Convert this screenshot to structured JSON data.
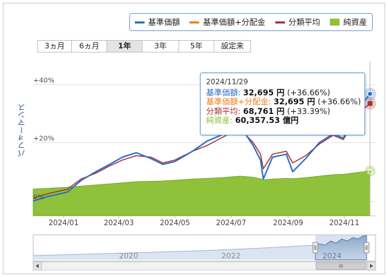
{
  "legend": {
    "items": [
      {
        "label": "基準価額",
        "color": "#2a6ec8",
        "kind": "line"
      },
      {
        "label": "基準価額+分配金",
        "color": "#f07d1d",
        "kind": "line"
      },
      {
        "label": "分類平均",
        "color": "#a83232",
        "kind": "line"
      },
      {
        "label": "純資産",
        "color": "#8fc13b",
        "kind": "box"
      }
    ]
  },
  "range_tabs": [
    {
      "label": "3ヵ月",
      "selected": false
    },
    {
      "label": "6ヵ月",
      "selected": false
    },
    {
      "label": "1年",
      "selected": true
    },
    {
      "label": "3年",
      "selected": false
    },
    {
      "label": "5年",
      "selected": false
    },
    {
      "label": "設定来",
      "selected": false
    }
  ],
  "tooltip": {
    "date": "2024/11/29",
    "rows": [
      {
        "label": "基準価額:",
        "value": "32,695 円",
        "rest": " (+36.66%)",
        "color": "#2a6ec8"
      },
      {
        "label": "基準価額+分配金:",
        "value": "32,695 円",
        "rest": " (+36.66%)",
        "color": "#f07d1d"
      },
      {
        "label": "分類平均:",
        "value": "68,761 円",
        "rest": " (+33.39%)",
        "color": "#a83232"
      },
      {
        "label": "純資産:",
        "value": "60,357.53 億円",
        "rest": "",
        "color": "#8fc13b"
      }
    ]
  },
  "navigator": {
    "year_labels": [
      "2020",
      "2022",
      "2024"
    ]
  },
  "chart_data": {
    "type": "line",
    "ylabel": "パフォーマンス",
    "y_tick_labels": [
      "+40%",
      "+20%",
      "0%"
    ],
    "y_ticks": [
      40,
      20,
      0
    ],
    "ylim": [
      -5,
      48
    ],
    "x_tick_labels": [
      "2024/01",
      "2024/03",
      "2024/05",
      "2024/07",
      "2024/09",
      "2024/11"
    ],
    "x_ticks": [
      "2024-01-01",
      "2024-03-01",
      "2024-05-01",
      "2024-07-01",
      "2024-09-01",
      "2024-11-01"
    ],
    "xlim": [
      "2023-11-29",
      "2024-12-05"
    ],
    "x": [
      "2023-11-29",
      "2023-12-15",
      "2024-01-05",
      "2024-01-20",
      "2024-02-05",
      "2024-02-20",
      "2024-03-05",
      "2024-03-20",
      "2024-04-05",
      "2024-04-18",
      "2024-05-01",
      "2024-05-20",
      "2024-06-05",
      "2024-06-20",
      "2024-07-05",
      "2024-07-11",
      "2024-07-25",
      "2024-08-02",
      "2024-08-05",
      "2024-08-15",
      "2024-08-30",
      "2024-09-06",
      "2024-09-20",
      "2024-10-05",
      "2024-10-20",
      "2024-10-31",
      "2024-11-15",
      "2024-11-29"
    ],
    "series": [
      {
        "name": "基準価額",
        "color": "#2a6ec8",
        "values": [
          0.0,
          1.5,
          3.0,
          7.0,
          10.0,
          12.5,
          15.0,
          16.5,
          14.5,
          12.5,
          13.5,
          17.0,
          20.5,
          22.5,
          25.0,
          25.5,
          19.0,
          14.0,
          7.5,
          15.0,
          16.0,
          10.0,
          14.5,
          20.0,
          23.0,
          21.5,
          31.0,
          36.66
        ]
      },
      {
        "name": "基準価額+分配金",
        "color": "#f07d1d",
        "values": [
          0.0,
          1.5,
          3.0,
          7.0,
          10.0,
          12.5,
          15.0,
          16.5,
          14.5,
          12.5,
          13.5,
          17.0,
          20.5,
          22.5,
          25.0,
          25.5,
          19.0,
          14.0,
          7.5,
          15.0,
          16.0,
          10.0,
          14.5,
          20.0,
          23.0,
          21.5,
          31.0,
          36.66
        ]
      },
      {
        "name": "分類平均",
        "color": "#a83232",
        "values": [
          1.0,
          2.5,
          4.0,
          7.5,
          9.5,
          12.0,
          14.0,
          15.5,
          15.0,
          13.0,
          14.0,
          17.0,
          19.0,
          21.5,
          24.0,
          24.5,
          20.0,
          16.0,
          11.0,
          16.0,
          17.0,
          13.0,
          15.5,
          19.5,
          22.5,
          21.0,
          29.5,
          33.39
        ]
      }
    ],
    "net_assets": {
      "name": "純資産",
      "color": "#8fc13b",
      "values": [
        36000,
        37000,
        38500,
        40000,
        41500,
        43000,
        44500,
        46000,
        46500,
        47000,
        48000,
        49500,
        50500,
        51500,
        53000,
        53500,
        52000,
        50000,
        48500,
        49500,
        50500,
        50000,
        51500,
        53500,
        55500,
        56000,
        58500,
        60357.53
      ]
    }
  }
}
